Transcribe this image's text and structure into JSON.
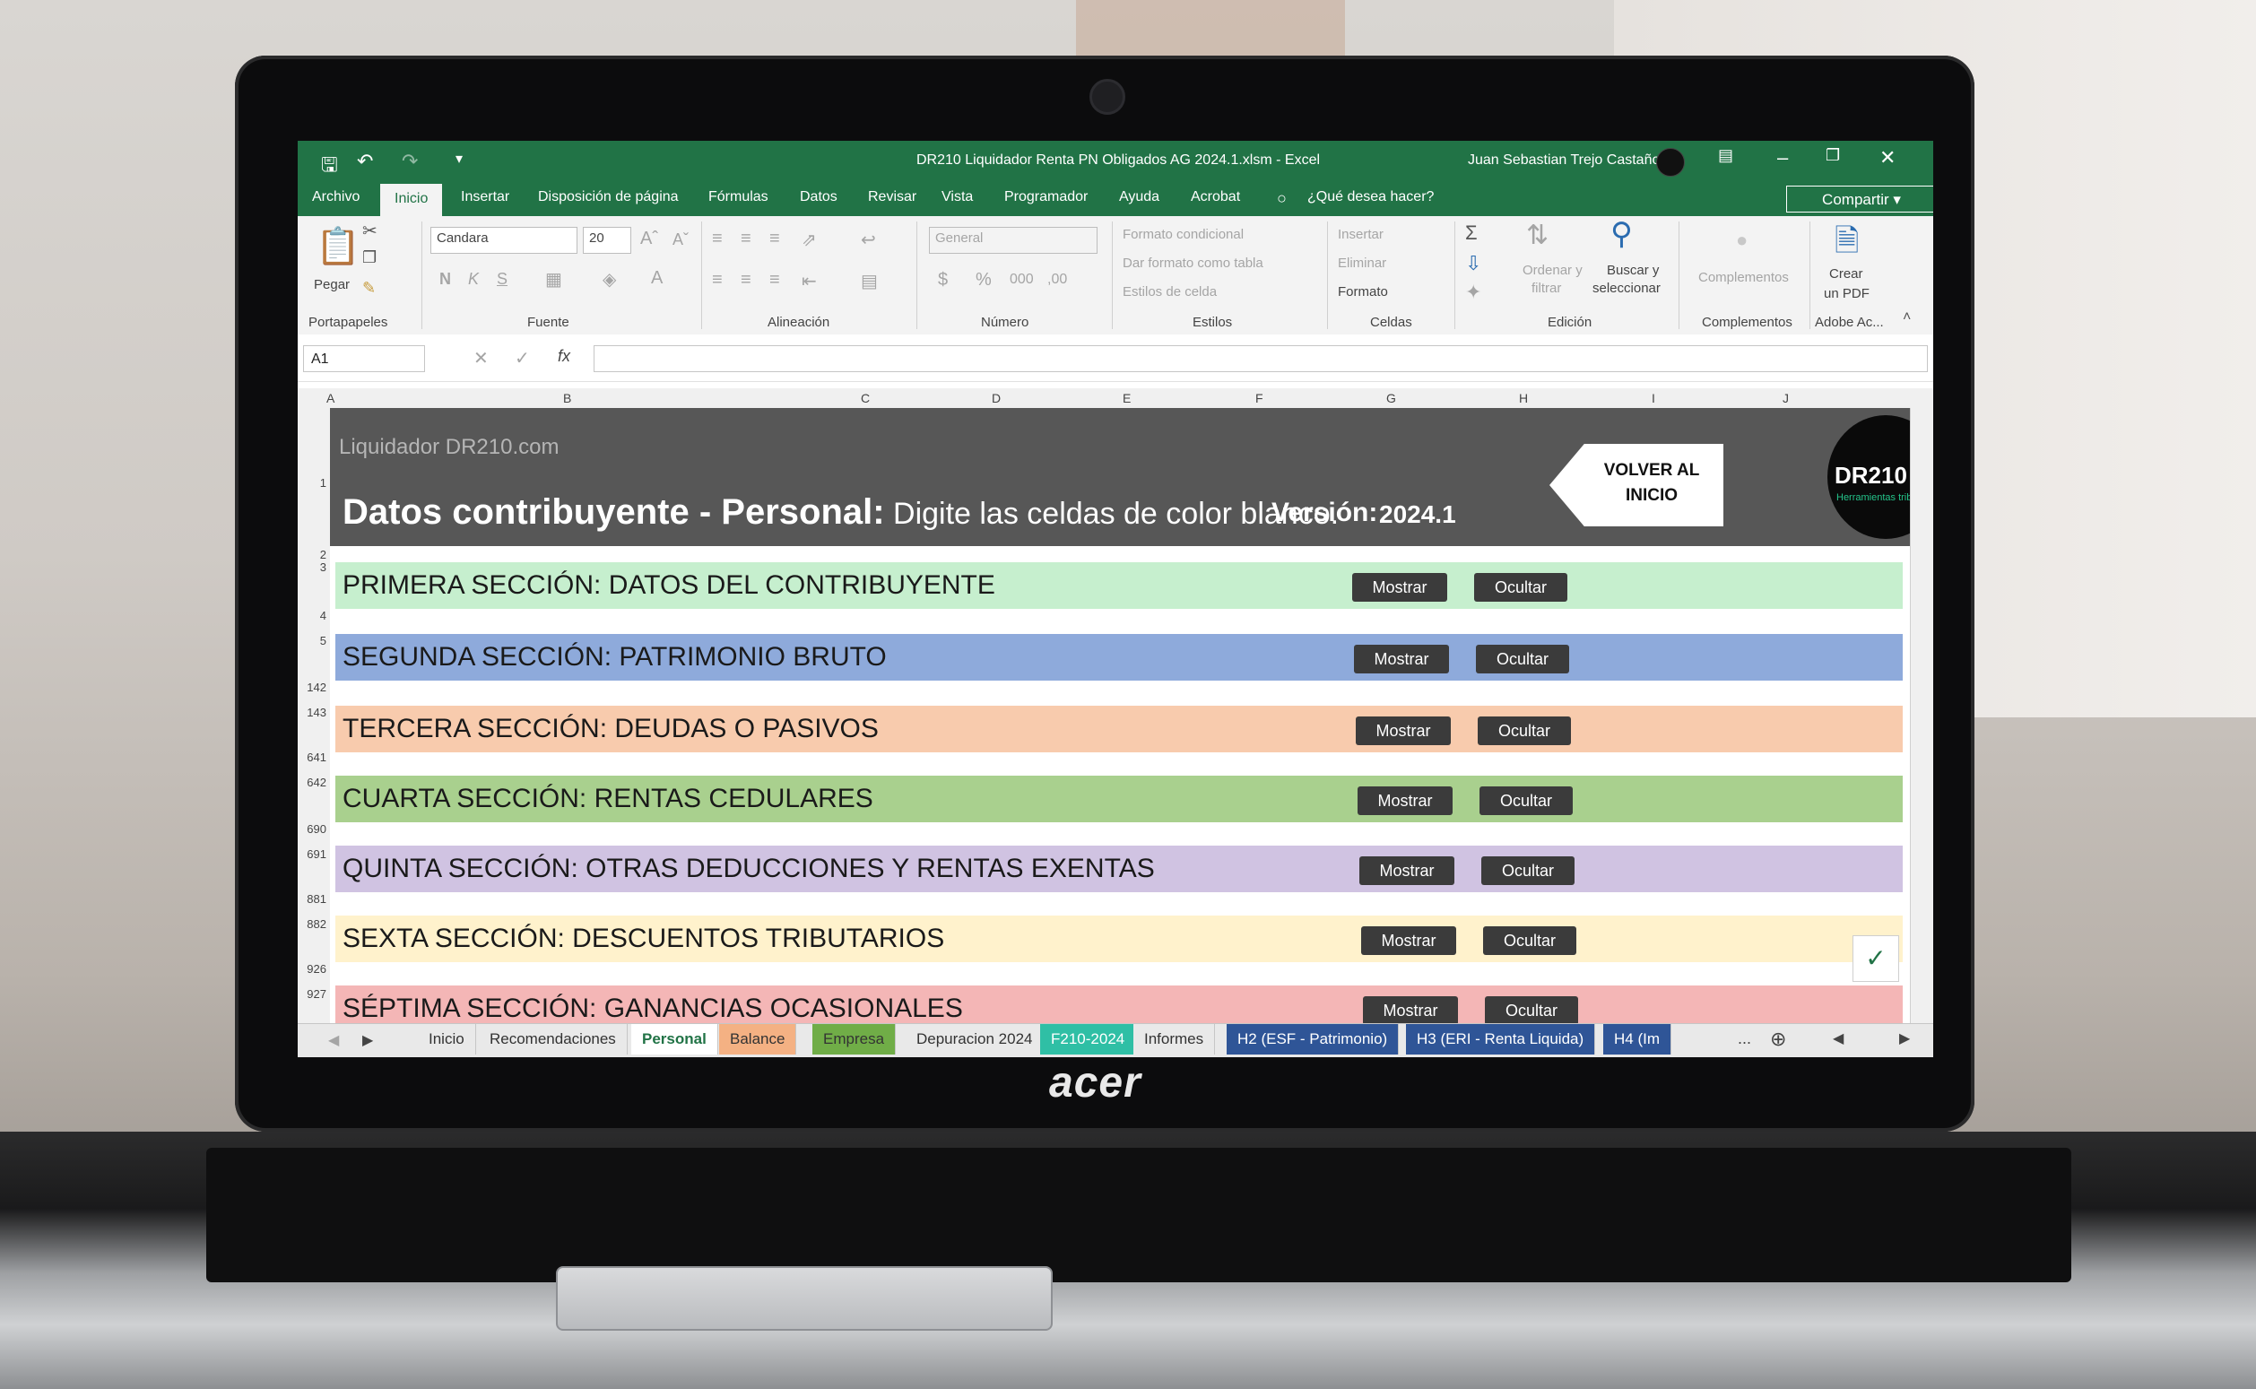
{
  "laptop": {
    "brand": "acer"
  },
  "titlebar": {
    "save_icon": "save-icon",
    "undo_icon": "undo-icon",
    "redo_icon": "redo-icon",
    "title": "DR210 Liquidador Renta PN Obligados AG 2024.1.xlsm  -  Excel",
    "user": "Juan Sebastian Trejo Castaño"
  },
  "menu": {
    "tabs": [
      "Archivo",
      "Inicio",
      "Insertar",
      "Disposición de página",
      "Fórmulas",
      "Datos",
      "Revisar",
      "Vista",
      "Programador",
      "Ayuda",
      "Acrobat"
    ],
    "tell_me": "¿Qué desea hacer?",
    "share": "Compartir"
  },
  "ribbon": {
    "paste": "Pegar",
    "font_name": "Candara",
    "font_size": "20",
    "bold": "N",
    "italic": "K",
    "underline": "S",
    "number_format": "General",
    "cond_format": "Formato condicional",
    "table_format": "Dar formato como tabla",
    "cell_styles": "Estilos de celda",
    "insert": "Insertar",
    "delete": "Eliminar",
    "format": "Formato",
    "sort_filter_1": "Ordenar y",
    "sort_filter_2": "filtrar",
    "find_select_1": "Buscar y",
    "find_select_2": "seleccionar",
    "complements": "Complementos",
    "pdf_1": "Crear",
    "pdf_2": "un PDF",
    "groups": [
      "Portapapeles",
      "Fuente",
      "Alineación",
      "Número",
      "Estilos",
      "Celdas",
      "Edición",
      "Complementos",
      "Adobe Ac..."
    ]
  },
  "formula_bar": {
    "name_box": "A1",
    "fx": "fx",
    "value": ""
  },
  "columns": [
    "A",
    "B",
    "C",
    "D",
    "E",
    "F",
    "G",
    "H",
    "I",
    "J"
  ],
  "rows": [
    "1",
    "2",
    "3",
    "4",
    "5",
    "142",
    "143",
    "641",
    "642",
    "690",
    "691",
    "881",
    "882",
    "926",
    "927"
  ],
  "sheet": {
    "brand": "Liquidador DR210.com",
    "title_bold": "Datos contribuyente - Personal:",
    "title_sub": " Digite las celdas de color blanco.",
    "version_label": "Versión:",
    "version_value": "2024.1",
    "back_button": "VOLVER AL INICIO",
    "logo": "DR210",
    "logo_sub": "Herramientas tributa",
    "show_label": "Mostrar",
    "hide_label": "Ocultar",
    "sections": [
      {
        "label": "PRIMERA SECCIÓN: DATOS DEL CONTRIBUYENTE",
        "color": "#c6efce"
      },
      {
        "label": "SEGUNDA SECCIÓN: PATRIMONIO BRUTO",
        "color": "#8eaadb"
      },
      {
        "label": "TERCERA SECCIÓN: DEUDAS O PASIVOS",
        "color": "#f8cbad"
      },
      {
        "label": "CUARTA SECCIÓN: RENTAS CEDULARES",
        "color": "#a9d08e"
      },
      {
        "label": "QUINTA SECCIÓN: OTRAS DEDUCCIONES Y RENTAS EXENTAS",
        "color": "#d0c3e2"
      },
      {
        "label": "SEXTA SECCIÓN: DESCUENTOS TRIBUTARIOS",
        "color": "#fff2cc"
      },
      {
        "label": "SÉPTIMA SECCIÓN: GANANCIAS OCASIONALES",
        "color": "#f4b6b6"
      }
    ]
  },
  "sheet_tabs": [
    {
      "label": "Inicio",
      "color": "#e9e9e9",
      "text": "#333333"
    },
    {
      "label": "Recomendaciones",
      "color": "#e9e9e9",
      "text": "#333333"
    },
    {
      "label": "Personal",
      "color": "#ffffff",
      "text": "#217346"
    },
    {
      "label": "Balance",
      "color": "#f4b183",
      "text": "#333333"
    },
    {
      "label": "Empresa",
      "color": "#70ad47",
      "text": "#333333"
    },
    {
      "label": "Depuracion 2024",
      "color": "#e9e9e9",
      "text": "#333333"
    },
    {
      "label": "F210-2024",
      "color": "#2fbfa5",
      "text": "#ffffff"
    },
    {
      "label": "Informes",
      "color": "#e9e9e9",
      "text": "#333333"
    },
    {
      "label": "H2 (ESF - Patrimonio)",
      "color": "#2f5597",
      "text": "#ffffff"
    },
    {
      "label": "H3 (ERI - Renta Liquida)",
      "color": "#2f5597",
      "text": "#ffffff"
    },
    {
      "label": "H4 (Im",
      "color": "#2f5597",
      "text": "#ffffff"
    }
  ],
  "tabs_more": "..."
}
